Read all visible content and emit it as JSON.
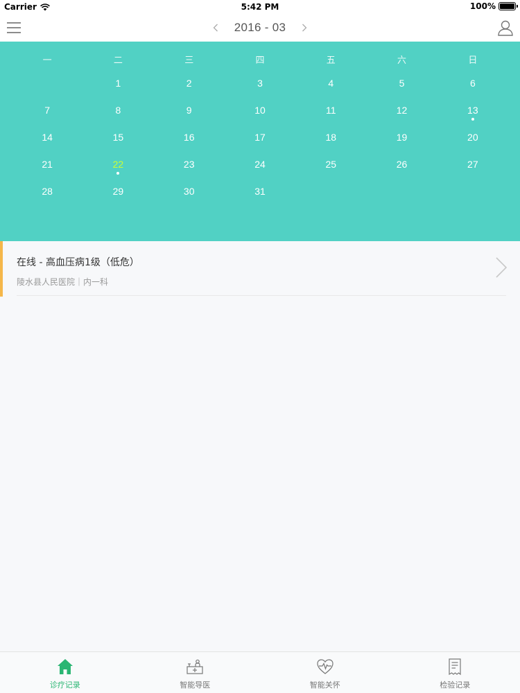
{
  "status": {
    "carrier": "Carrier",
    "time": "5:42 PM",
    "battery": "100%"
  },
  "nav": {
    "month_title": "2016 - 03"
  },
  "calendar": {
    "weekdays": [
      "一",
      "二",
      "三",
      "四",
      "五",
      "六",
      "日"
    ],
    "weeks": [
      [
        "",
        "1",
        "2",
        "3",
        "4",
        "5",
        "6"
      ],
      [
        "7",
        "8",
        "9",
        "10",
        "11",
        "12",
        "13"
      ],
      [
        "14",
        "15",
        "16",
        "17",
        "18",
        "19",
        "20"
      ],
      [
        "21",
        "22",
        "23",
        "24",
        "25",
        "26",
        "27"
      ],
      [
        "28",
        "29",
        "30",
        "31",
        "",
        "",
        ""
      ]
    ],
    "today": "22",
    "marked_days": [
      "13",
      "22"
    ]
  },
  "record": {
    "title": "在线 - 高血压病1级（低危）",
    "subtitle": "陵水县人民医院｜内一科"
  },
  "tabs": [
    {
      "label": "诊疗记录",
      "active": true
    },
    {
      "label": "智能导医",
      "active": false
    },
    {
      "label": "智能关怀",
      "active": false
    },
    {
      "label": "检验记录",
      "active": false
    }
  ],
  "colors": {
    "calendar_bg": "#51d1c4",
    "accent": "#2bb673",
    "today": "#ccff33",
    "record_accent": "#f5b74a"
  }
}
